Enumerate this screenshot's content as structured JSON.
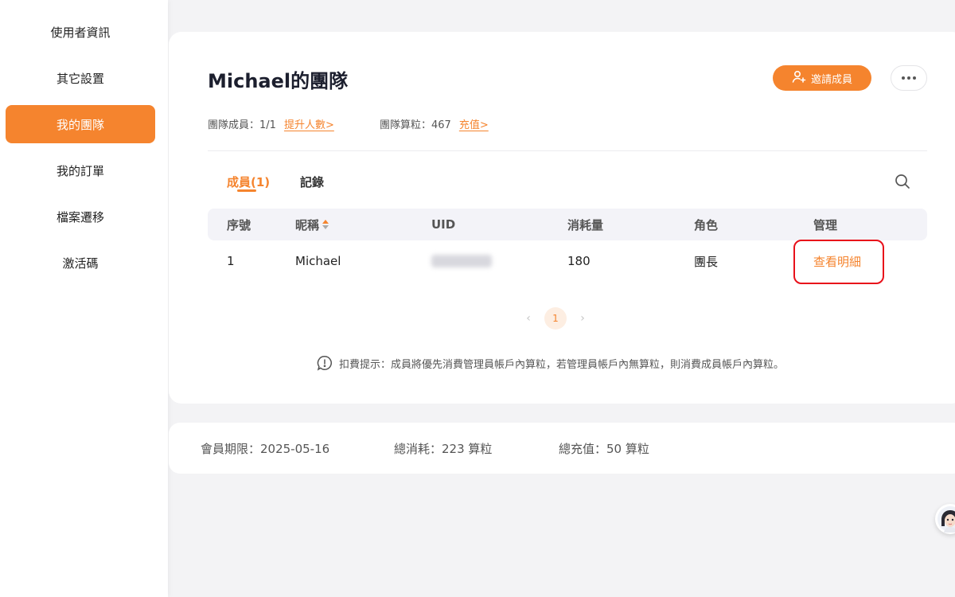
{
  "sidebar": {
    "items": [
      {
        "label": "使用者資訊"
      },
      {
        "label": "其它設置"
      },
      {
        "label": "我的團隊"
      },
      {
        "label": "我的訂單"
      },
      {
        "label": "檔案遷移"
      },
      {
        "label": "激活碼"
      }
    ],
    "active_index": 2
  },
  "team": {
    "title": "Michael的團隊",
    "invite_label": "邀請成員",
    "members_label": "團隊成員：",
    "members_value": "1/1",
    "upgrade_link": "提升人數>",
    "credits_label": "團隊算粒：",
    "credits_value": "467",
    "recharge_link": "充值>"
  },
  "tabs": [
    {
      "label": "成員(1)",
      "active": true
    },
    {
      "label": "記錄",
      "active": false
    }
  ],
  "table": {
    "headers": [
      "序號",
      "昵稱",
      "UID",
      "消耗量",
      "角色",
      "管理"
    ],
    "rows": [
      {
        "index": "1",
        "nickname": "Michael",
        "consumption": "180",
        "role": "團長",
        "action": "查看明細"
      }
    ]
  },
  "pagination": {
    "current_page": "1"
  },
  "notice": "扣費提示：成員將優先消費管理員帳戶內算粒，若管理員帳戶內無算粒，則消費成員帳戶內算粒。",
  "summary": {
    "expiry": "會員期限：2025-05-16",
    "total_consumption": "總消耗：223 算粒",
    "total_recharge": "總充值：50 算粒"
  },
  "colors": {
    "accent": "#f5842e",
    "highlight": "#e8101a"
  }
}
